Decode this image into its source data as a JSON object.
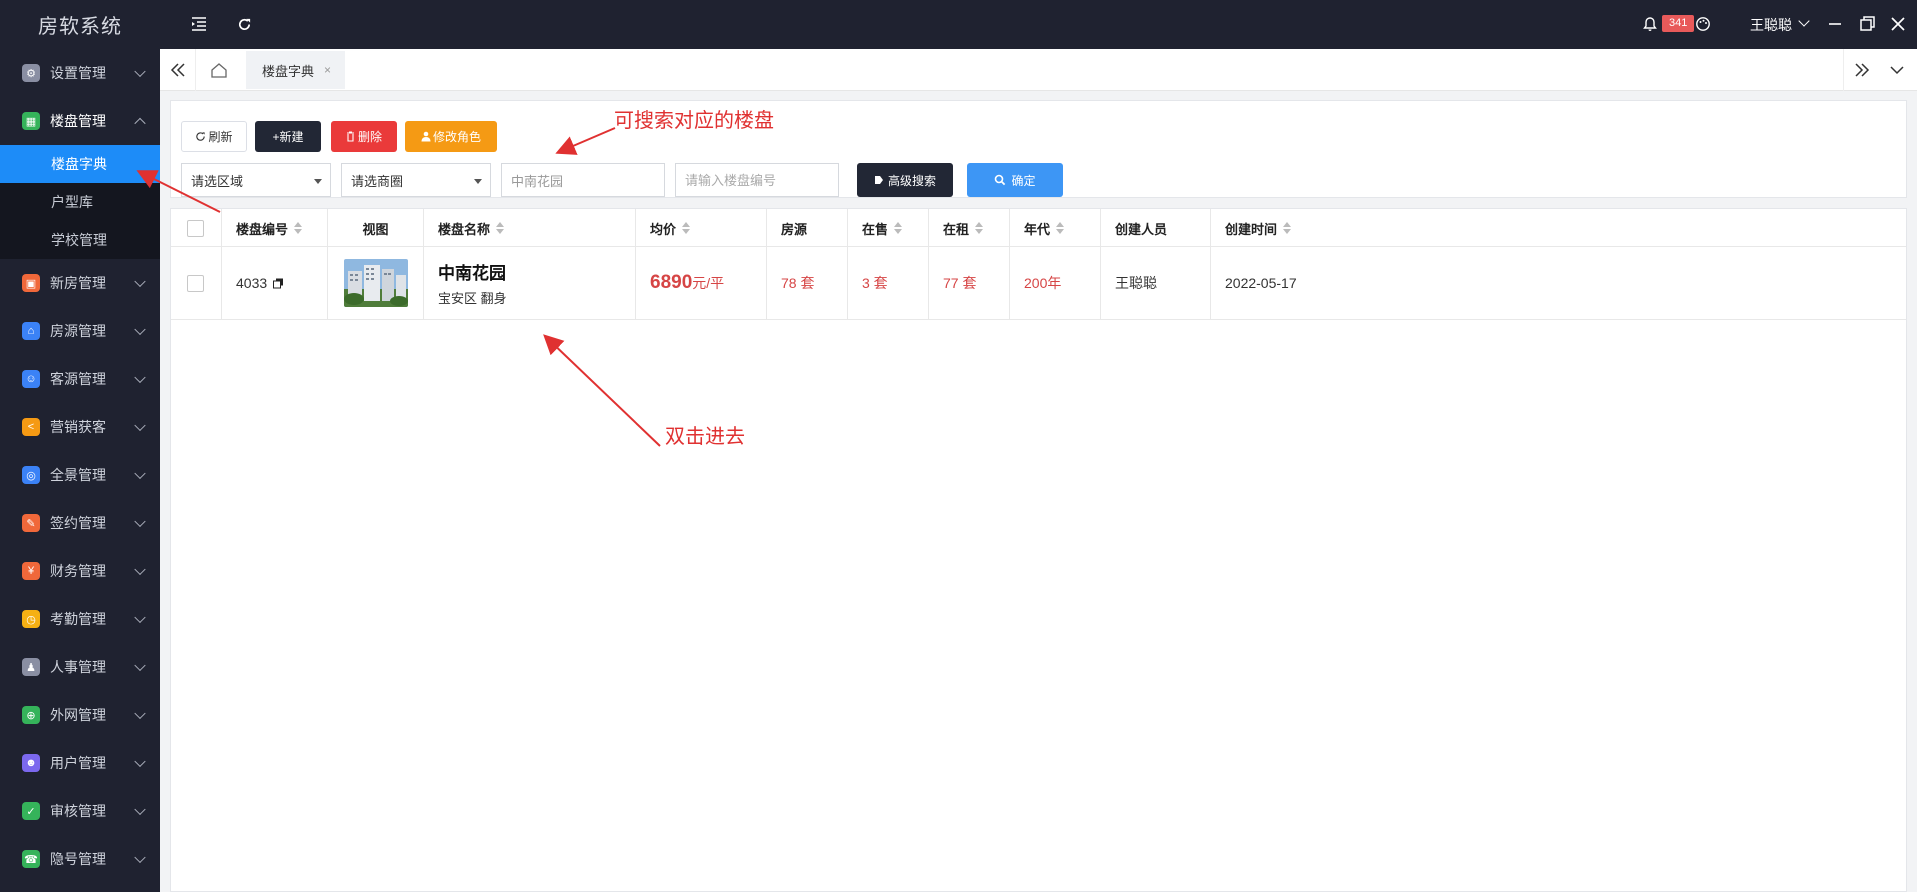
{
  "app": {
    "title": "房软系统"
  },
  "sidebar": {
    "items": [
      {
        "label": "设置管理",
        "icon": "gear-icon",
        "color": "#8a8fa3",
        "glyph": "⚙"
      },
      {
        "label": "楼盘管理",
        "icon": "building-icon",
        "color": "#35b35a",
        "glyph": "▦",
        "open": true,
        "children": [
          {
            "label": "楼盘字典",
            "active": true
          },
          {
            "label": "户型库"
          },
          {
            "label": "学校管理"
          }
        ]
      },
      {
        "label": "新房管理",
        "icon": "new-house-icon",
        "color": "#f0683a",
        "glyph": "▣"
      },
      {
        "label": "房源管理",
        "icon": "home-icon",
        "color": "#3b82f6",
        "glyph": "⌂"
      },
      {
        "label": "客源管理",
        "icon": "customers-icon",
        "color": "#3b82f6",
        "glyph": "☺"
      },
      {
        "label": "营销获客",
        "icon": "share-icon",
        "color": "#f59a14",
        "glyph": "<"
      },
      {
        "label": "全景管理",
        "icon": "panorama-icon",
        "color": "#3b82f6",
        "glyph": "◎"
      },
      {
        "label": "签约管理",
        "icon": "contract-icon",
        "color": "#f0683a",
        "glyph": "✎"
      },
      {
        "label": "财务管理",
        "icon": "finance-icon",
        "color": "#f0683a",
        "glyph": "¥"
      },
      {
        "label": "考勤管理",
        "icon": "attendance-icon",
        "color": "#f5b014",
        "glyph": "◷"
      },
      {
        "label": "人事管理",
        "icon": "org-icon",
        "color": "#8a8fa3",
        "glyph": "♟"
      },
      {
        "label": "外网管理",
        "icon": "network-icon",
        "color": "#35b35a",
        "glyph": "⊕"
      },
      {
        "label": "用户管理",
        "icon": "user-icon",
        "color": "#7b68ee",
        "glyph": "☻"
      },
      {
        "label": "审核管理",
        "icon": "audit-icon",
        "color": "#35b35a",
        "glyph": "✓"
      },
      {
        "label": "隐号管理",
        "icon": "phone-icon",
        "color": "#35b35a",
        "glyph": "☎"
      }
    ]
  },
  "topbar": {
    "notifications": "341",
    "user": "王聪聪"
  },
  "tabs": [
    {
      "label": "楼盘字典",
      "close": "×"
    }
  ],
  "toolbar": {
    "refresh": "刷新",
    "new": "+新建",
    "delete": "删除",
    "modify_role": "修改角色",
    "area_select": "请选区域",
    "district_select": "请选商圈",
    "name_input_value": "中南花园",
    "code_input_placeholder": "请输入楼盘编号",
    "advanced_search": "高级搜索",
    "confirm": "确定"
  },
  "table": {
    "headers": [
      "楼盘编号",
      "视图",
      "楼盘名称",
      "均价",
      "房源",
      "在售",
      "在租",
      "年代",
      "创建人员",
      "创建时间"
    ],
    "rows": [
      {
        "code": "4033",
        "name": "中南花园",
        "location": "宝安区 翻身",
        "price": "6890",
        "price_unit": "元/平",
        "houses": "78 套",
        "on_sale": "3 套",
        "on_rent": "77 套",
        "year": "200年",
        "creator": "王聪聪",
        "created": "2022-05-17"
      }
    ]
  },
  "annotations": {
    "search_hint": "可搜索对应的楼盘",
    "double_click_hint": "双击进去"
  },
  "colors": {
    "sidebar_bg": "#1f2230",
    "accent_blue": "#1d8cf8",
    "danger_red": "#ea3a3a",
    "warning_orange": "#f59a14",
    "price_red": "#d64545"
  }
}
